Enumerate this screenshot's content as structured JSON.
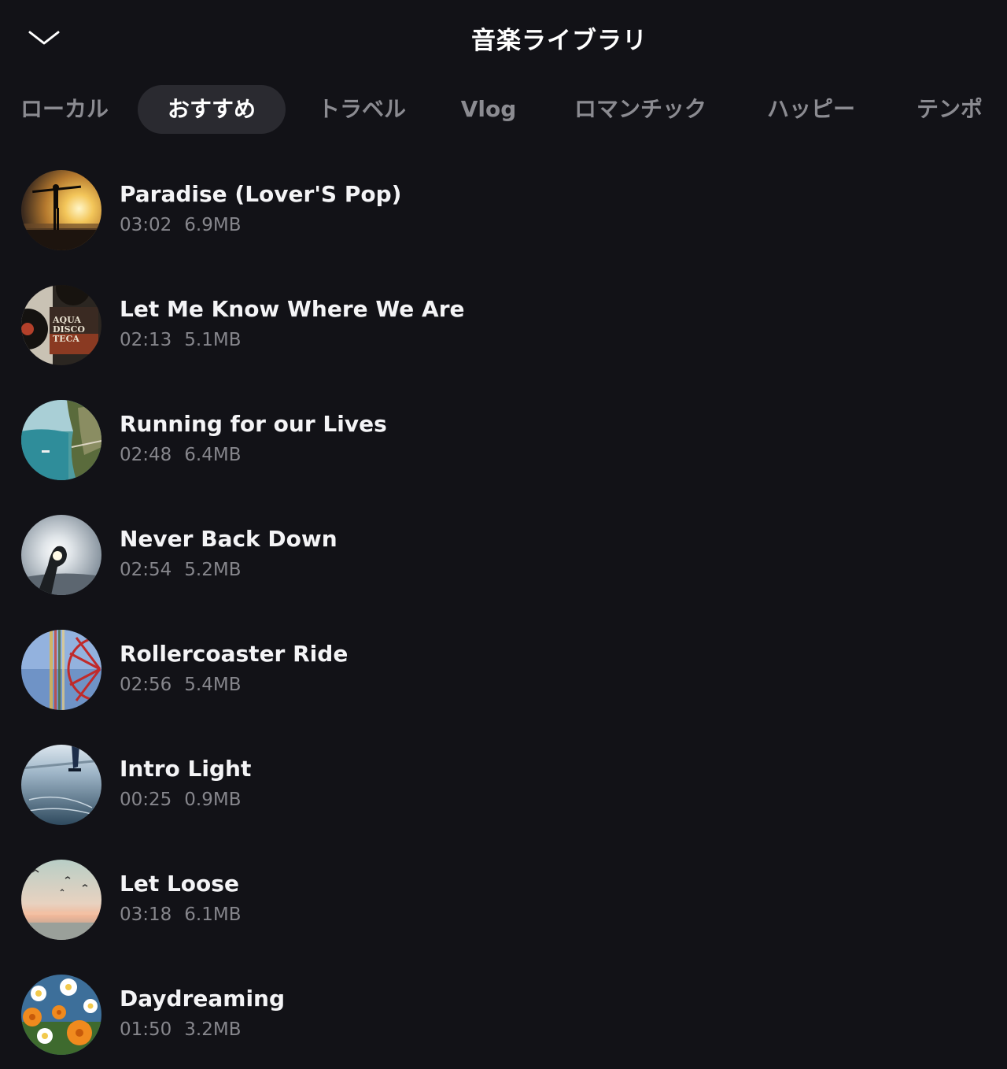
{
  "header": {
    "title": "音楽ライブラリ",
    "collapse_icon": "chevron-down-icon"
  },
  "tabs": [
    {
      "label": "ローカル",
      "active": false
    },
    {
      "label": "おすすめ",
      "active": true
    },
    {
      "label": "トラベル",
      "active": false
    },
    {
      "label": "Vlog",
      "active": false
    },
    {
      "label": "ロマンチック",
      "active": false
    },
    {
      "label": "ハッピー",
      "active": false
    },
    {
      "label": "テンポ",
      "active": false
    }
  ],
  "tracks": [
    {
      "title": " Paradise (Lover'S Pop)",
      "duration": "03:02",
      "size": "6.9MB",
      "cover": "sunset-silhouette"
    },
    {
      "title": "Let Me Know Where We Are",
      "duration": "02:13",
      "size": "5.1MB",
      "cover": "vinyl-records-aqua-disco-teca"
    },
    {
      "title": "Running for our Lives",
      "duration": "02:48",
      "size": "6.4MB",
      "cover": "coastal-cliff-boat"
    },
    {
      "title": "Never Back Down",
      "duration": "02:54",
      "size": "5.2MB",
      "cover": "hand-sunlight-sky"
    },
    {
      "title": "Rollercoaster Ride",
      "duration": "02:56",
      "size": "5.4MB",
      "cover": "ferris-wheel-motion"
    },
    {
      "title": "Intro Light",
      "duration": "00:25",
      "size": "0.9MB",
      "cover": "ice-skating"
    },
    {
      "title": "Let Loose",
      "duration": "03:18",
      "size": "6.1MB",
      "cover": "beach-sunset-birds"
    },
    {
      "title": "Daydreaming",
      "duration": "01:50",
      "size": "3.2MB",
      "cover": "daisy-flowers"
    }
  ],
  "colors": {
    "background": "#121217",
    "active_tab_bg": "#2a2a30",
    "inactive_text": "#8b8b91",
    "meta_text": "#86868c"
  }
}
